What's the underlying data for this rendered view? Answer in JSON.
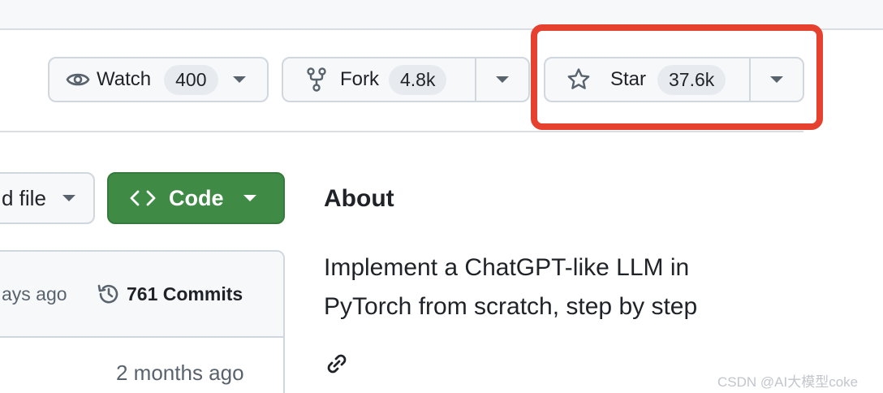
{
  "actions": {
    "watch": {
      "label": "Watch",
      "count": "400"
    },
    "fork": {
      "label": "Fork",
      "count": "4.8k"
    },
    "star": {
      "label": "Star",
      "count": "37.6k"
    }
  },
  "toolbar": {
    "add_file_label": "d file",
    "code_label": "Code"
  },
  "files": {
    "latest_commit_time": "ays ago",
    "commits_label": "761 Commits",
    "row_time": "2 months ago"
  },
  "about": {
    "title": "About",
    "description_line1": "Implement a ChatGPT-like LLM in",
    "description_line2": "PyTorch from scratch, step by step"
  },
  "watermark": "CSDN @AI大模型coke",
  "icons": {
    "watch": "eye-icon",
    "fork": "fork-icon",
    "star": "star-icon",
    "code": "code-icon",
    "history": "history-icon",
    "link": "link-icon"
  },
  "colors": {
    "code_button": "#3f8b46",
    "highlight": "#e6402e"
  }
}
